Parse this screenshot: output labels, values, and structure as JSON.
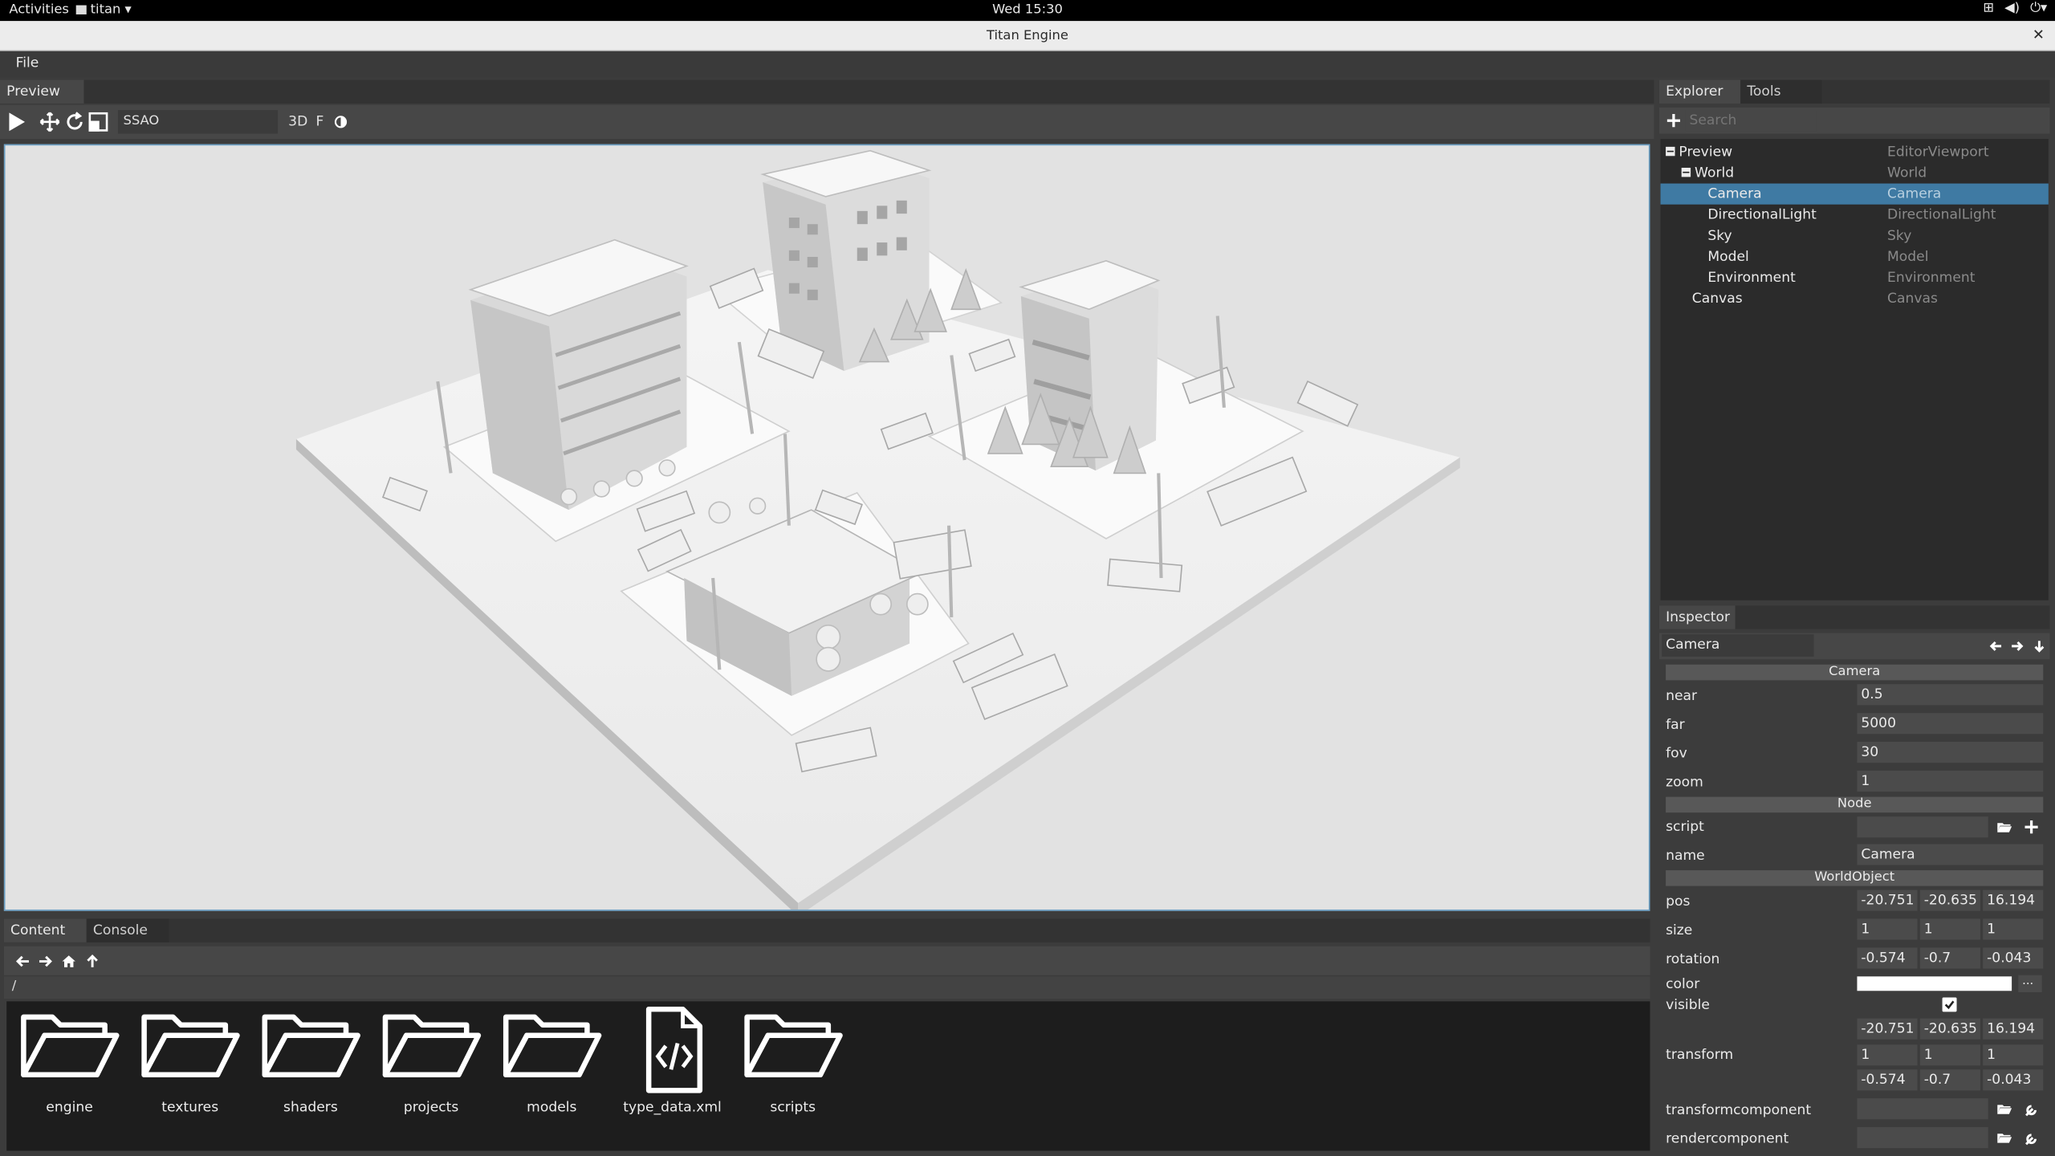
{
  "system_bar": {
    "activities": "Activities",
    "app_menu": "titan",
    "clock": "Wed 15:30"
  },
  "window": {
    "title": "Titan Engine"
  },
  "menu": {
    "file": "File"
  },
  "preview_panel": {
    "tab": "Preview",
    "effect_field": "SSAO",
    "mode_3d": "3D",
    "mode_f": "F"
  },
  "content_panel": {
    "tabs": [
      "Content",
      "Console"
    ],
    "path": "/",
    "items": [
      {
        "label": "engine",
        "icon": "folder-icon"
      },
      {
        "label": "textures",
        "icon": "folder-icon"
      },
      {
        "label": "shaders",
        "icon": "folder-icon"
      },
      {
        "label": "projects",
        "icon": "folder-icon"
      },
      {
        "label": "models",
        "icon": "folder-icon"
      },
      {
        "label": "type_data.xml",
        "icon": "code-file-icon"
      },
      {
        "label": "scripts",
        "icon": "folder-icon"
      }
    ]
  },
  "explorer": {
    "tabs": [
      "Explorer",
      "Tools"
    ],
    "search_placeholder": "Search",
    "tree": [
      {
        "name": "Preview",
        "type": "EditorViewport"
      },
      {
        "name": "World",
        "type": "World"
      },
      {
        "name": "Camera",
        "type": "Camera",
        "selected": true
      },
      {
        "name": "DirectionalLight",
        "type": "DirectionalLight"
      },
      {
        "name": "Sky",
        "type": "Sky"
      },
      {
        "name": "Model",
        "type": "Model"
      },
      {
        "name": "Environment",
        "type": "Environment"
      },
      {
        "name": "Canvas",
        "type": "Canvas"
      }
    ]
  },
  "inspector": {
    "tab": "Inspector",
    "object_name": "Camera",
    "sections": {
      "camera": "Camera",
      "node": "Node",
      "world_object": "WorldObject"
    },
    "labels": {
      "near": "near",
      "far": "far",
      "fov": "fov",
      "zoom": "zoom",
      "script": "script",
      "name": "name",
      "pos": "pos",
      "size": "size",
      "rotation": "rotation",
      "color": "color",
      "visible": "visible",
      "transform": "transform",
      "transformcomponent": "transformcomponent",
      "rendercomponent": "rendercomponent"
    },
    "values": {
      "near": "0.5",
      "far": "5000",
      "fov": "30",
      "zoom": "1",
      "script": "",
      "name": "Camera",
      "pos": [
        "-20.751",
        "-20.635",
        "16.194"
      ],
      "size": [
        "1",
        "1",
        "1"
      ],
      "rotation": [
        "-0.574",
        "-0.7",
        "-0.043"
      ],
      "color": "#ffffff",
      "color_picker": "...",
      "visible": true,
      "transform": [
        [
          "-20.751",
          "-20.635",
          "16.194"
        ],
        [
          "1",
          "1",
          "1"
        ],
        [
          "-0.574",
          "-0.7",
          "-0.043"
        ]
      ]
    }
  },
  "colors": {
    "selection": "#3f7aa3",
    "viewport_bg": "#e2e2e2",
    "panel_bg": "#3c3c3c"
  }
}
